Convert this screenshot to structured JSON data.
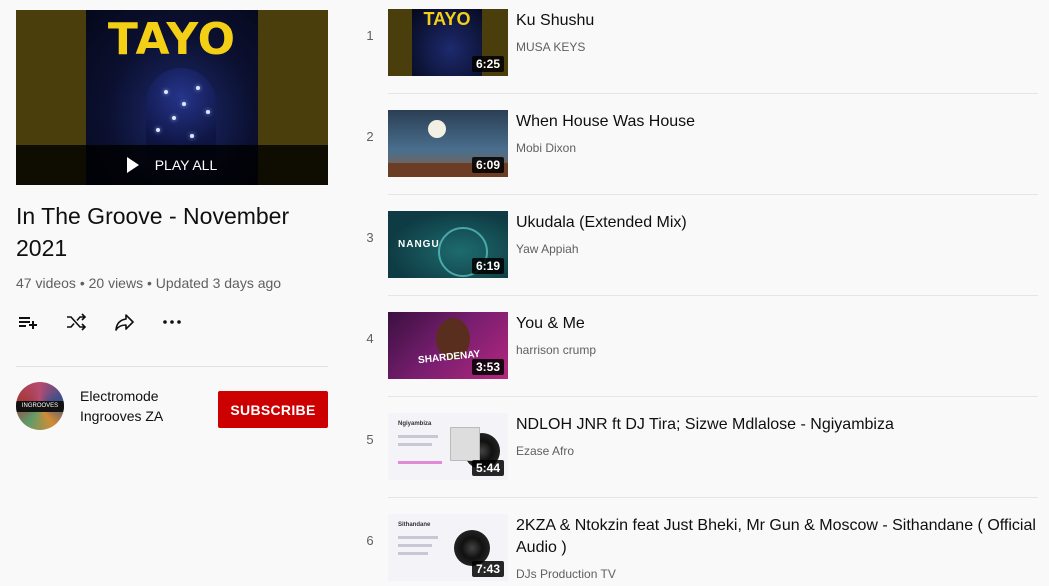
{
  "playlist": {
    "thumbnail_text": "TAYO",
    "play_all_label": "PLAY ALL",
    "title": "In The Groove - November 2021",
    "meta": "47 videos • 20 views • Updated 3 days ago",
    "actions": [
      {
        "name": "add-to-queue-icon"
      },
      {
        "name": "shuffle-icon"
      },
      {
        "name": "share-icon"
      },
      {
        "name": "more-options-icon"
      }
    ]
  },
  "channel": {
    "name": "Electromode Ingrooves ZA",
    "avatar_text": "INGROOVES",
    "subscribe_label": "SUBSCRIBE"
  },
  "videos": [
    {
      "index": "1",
      "title": "Ku Shushu",
      "channel": "MUSA KEYS",
      "duration": "6:25",
      "thumb_text": "TAYO"
    },
    {
      "index": "2",
      "title": "When House Was House",
      "channel": "Mobi Dixon",
      "duration": "6:09"
    },
    {
      "index": "3",
      "title": "Ukudala (Extended Mix)",
      "channel": "Yaw Appiah",
      "duration": "6:19",
      "thumb_text": "NANGU"
    },
    {
      "index": "4",
      "title": "You & Me",
      "channel": "harrison crump",
      "duration": "3:53",
      "thumb_text": "SHARDENAY"
    },
    {
      "index": "5",
      "title": "NDLOH JNR ft DJ Tira; Sizwe Mdlalose - Ngiyambiza",
      "channel": "Ezase Afro",
      "duration": "5:44",
      "thumb_text": "Ngiyambiza"
    },
    {
      "index": "6",
      "title": "2KZA & Ntokzin feat Just Bheki, Mr Gun & Moscow - Sithandane ( Official Audio )",
      "channel": "DJs Production TV",
      "duration": "7:43",
      "thumb_text": "Sithandane"
    }
  ],
  "colors": {
    "subscribe": "#cc0000",
    "thumb_bg": "#4a3f0c",
    "accent_yellow": "#f3cf15"
  }
}
